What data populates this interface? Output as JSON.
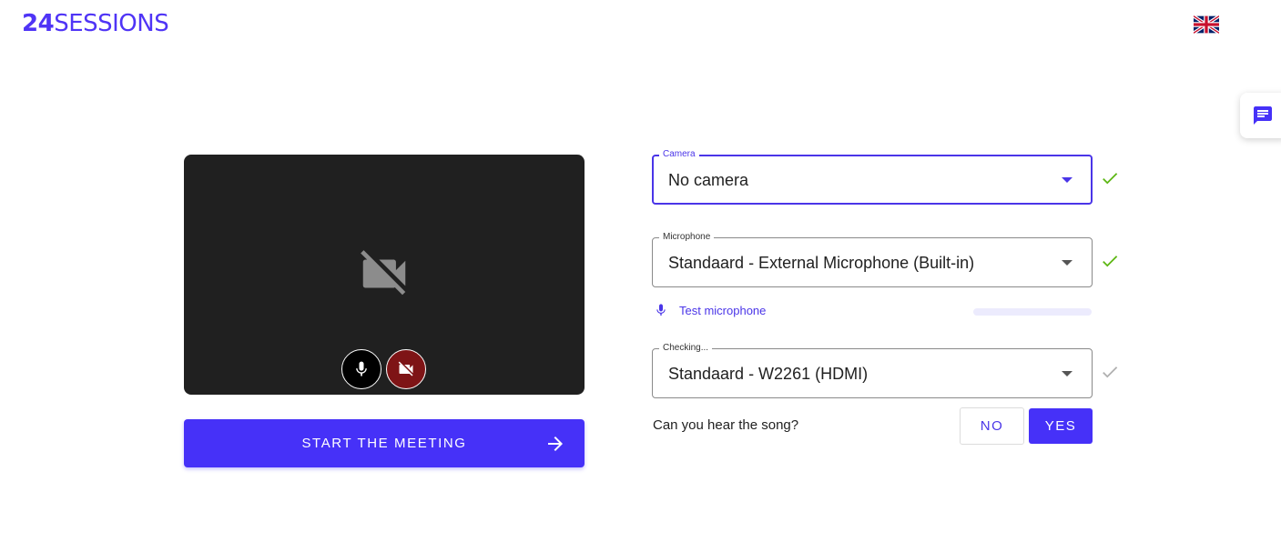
{
  "header": {
    "logo_number": "24",
    "logo_word": "SESSIONS",
    "language_icon": "uk-flag-icon"
  },
  "chat": {
    "icon": "chat-icon"
  },
  "preview": {
    "camera_off_icon": "videocam-off-icon",
    "mic_button_icon": "microphone-icon",
    "camera_button_icon": "videocam-off-icon"
  },
  "start_button": {
    "label": "START THE MEETING",
    "icon": "arrow-right-icon"
  },
  "camera": {
    "label": "Camera",
    "value": "No camera",
    "status_icon": "check-icon",
    "status_color": "#5db714"
  },
  "microphone": {
    "label": "Microphone",
    "value": "Standaard - External Microphone (Built-in)",
    "status_icon": "check-icon",
    "status_color": "#5db714"
  },
  "test_microphone": {
    "label": "Test microphone",
    "icon": "microphone-icon",
    "level": 0
  },
  "speaker": {
    "label": "Checking...",
    "value": "Standaard - W2261 (HDMI)",
    "status_icon": "check-icon",
    "status_color": "#b0b0b0"
  },
  "song_check": {
    "question": "Can you hear the song?",
    "no_label": "NO",
    "yes_label": "YES"
  },
  "colors": {
    "accent": "#4631f8",
    "cam_off_button": "#7e1416",
    "preview_bg": "#202020"
  }
}
